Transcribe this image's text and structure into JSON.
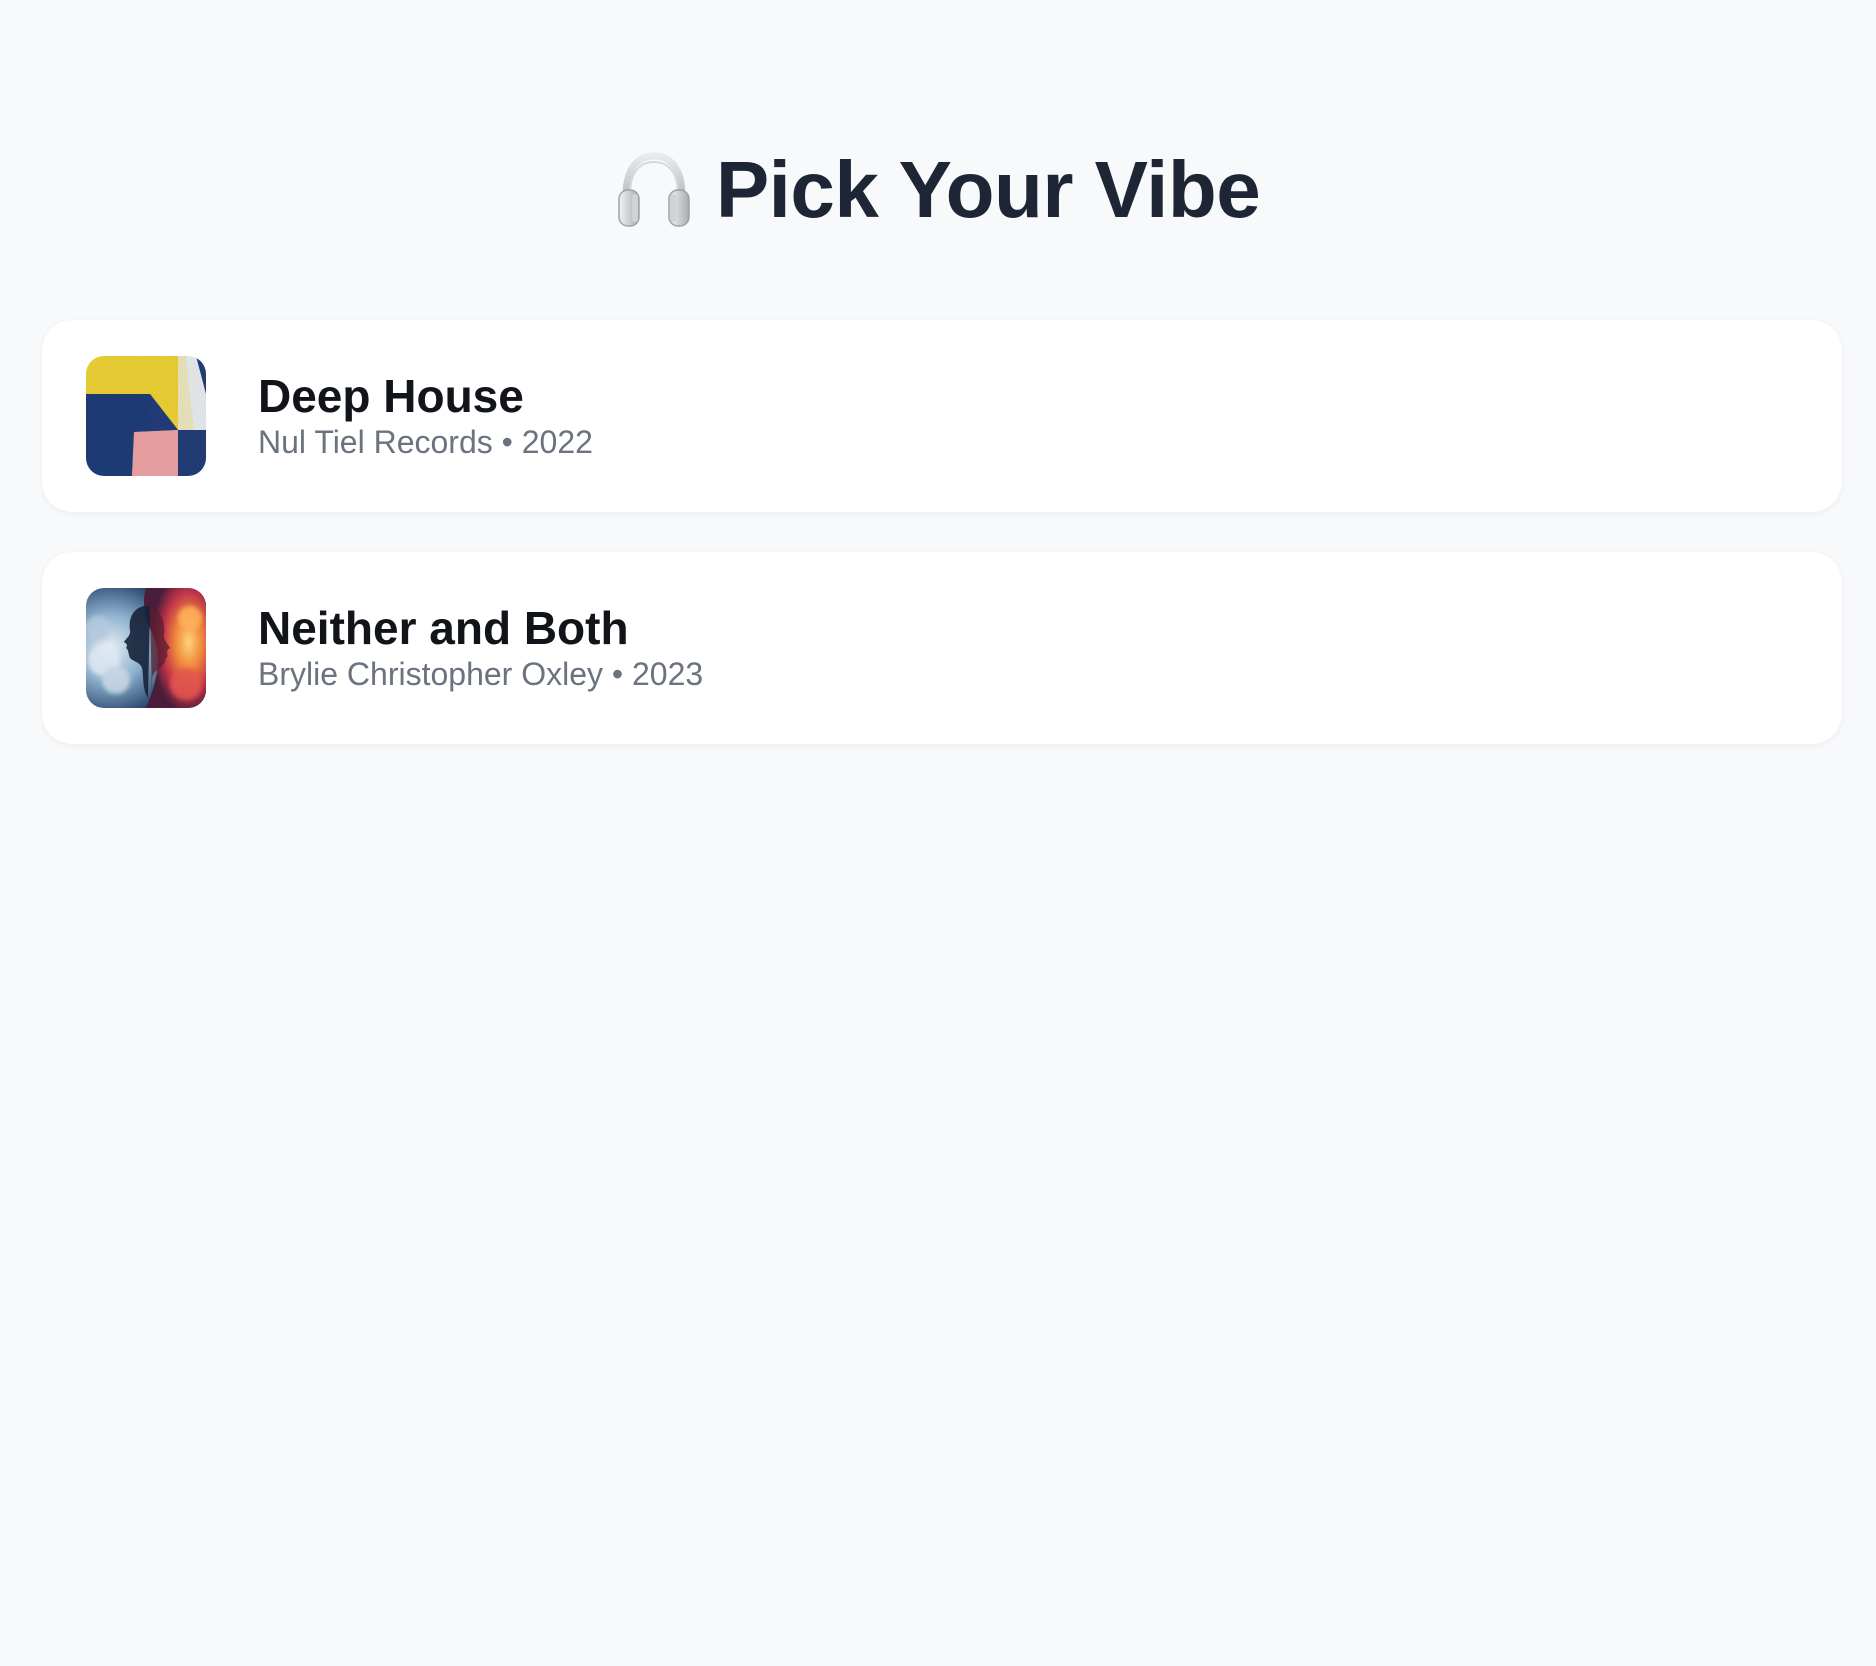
{
  "header": {
    "icon": "headphones-icon",
    "title": "Pick Your Vibe"
  },
  "albums": [
    {
      "title": "Deep House",
      "artist": "Nul Tiel Records",
      "separator": "•",
      "year": "2022",
      "cover_icon": "abstract-blue-yellow-cover"
    },
    {
      "title": "Neither and Both",
      "artist": "Brylie Christopher Oxley",
      "separator": "•",
      "year": "2023",
      "cover_icon": "cloud-face-cover"
    }
  ],
  "colors": {
    "background": "#f8f9fb",
    "title": "#1e2636",
    "card": "#ffffff",
    "album_title": "#111418",
    "album_meta": "#6b7280"
  }
}
